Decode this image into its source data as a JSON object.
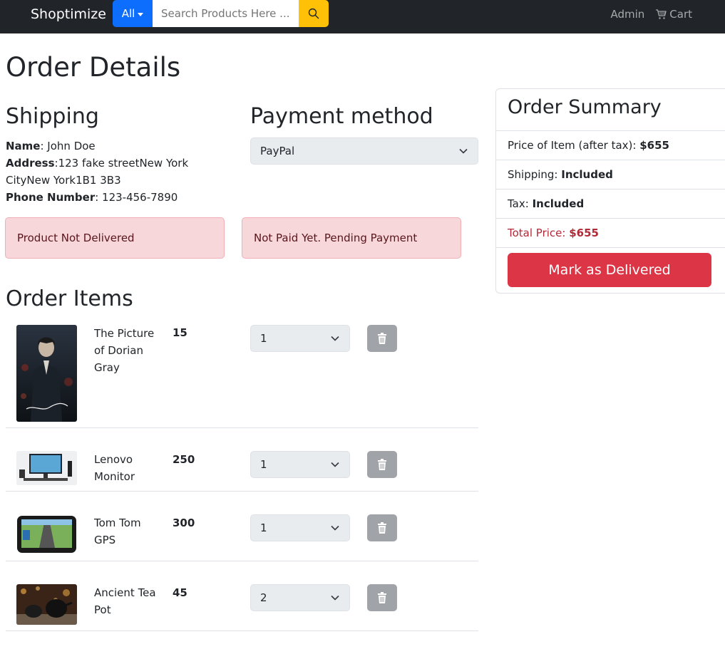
{
  "nav": {
    "brand": "Shoptimize",
    "search_category": "All",
    "search_placeholder": "Search Products Here ...",
    "admin_label": "Admin",
    "cart_label": "Cart"
  },
  "page": {
    "title": "Order Details"
  },
  "shipping": {
    "heading": "Shipping",
    "name_label": "Name",
    "name_value": ": John Doe",
    "address_label": "Address",
    "address_value": ":123 fake streetNew York CityNew York1B1 3B3",
    "phone_label": "Phone Number",
    "phone_value": ": 123-456-7890",
    "delivery_status": "Product Not Delivered"
  },
  "payment": {
    "heading": "Payment method",
    "selected": "PayPal",
    "status": "Not Paid Yet. Pending Payment"
  },
  "items": {
    "heading": "Order Items",
    "list": [
      {
        "name": "The Picture of Dorian Gray",
        "price": "15",
        "qty": "1",
        "image": "book-cover"
      },
      {
        "name": "Lenovo Monitor",
        "price": "250",
        "qty": "1",
        "image": "monitor-photo"
      },
      {
        "name": "Tom Tom GPS",
        "price": "300",
        "qty": "1",
        "image": "gps-photo"
      },
      {
        "name": "Ancient Tea Pot",
        "price": "45",
        "qty": "2",
        "image": "teapot-photo"
      }
    ]
  },
  "summary": {
    "title": "Order Summary",
    "price_label": "Price of Item (after tax): ",
    "price_value": "$655",
    "shipping_label": "Shipping: ",
    "shipping_value": "Included",
    "tax_label": "Tax: ",
    "tax_value": "Included",
    "total_label": "Total Price: ",
    "total_value": "$655",
    "deliver_button": "Mark as Delivered"
  },
  "colors": {
    "navbar": "#212529",
    "primary": "#0d6efd",
    "warning": "#ffc107",
    "danger": "#dc3545",
    "alert_bg": "#f8d7da"
  }
}
